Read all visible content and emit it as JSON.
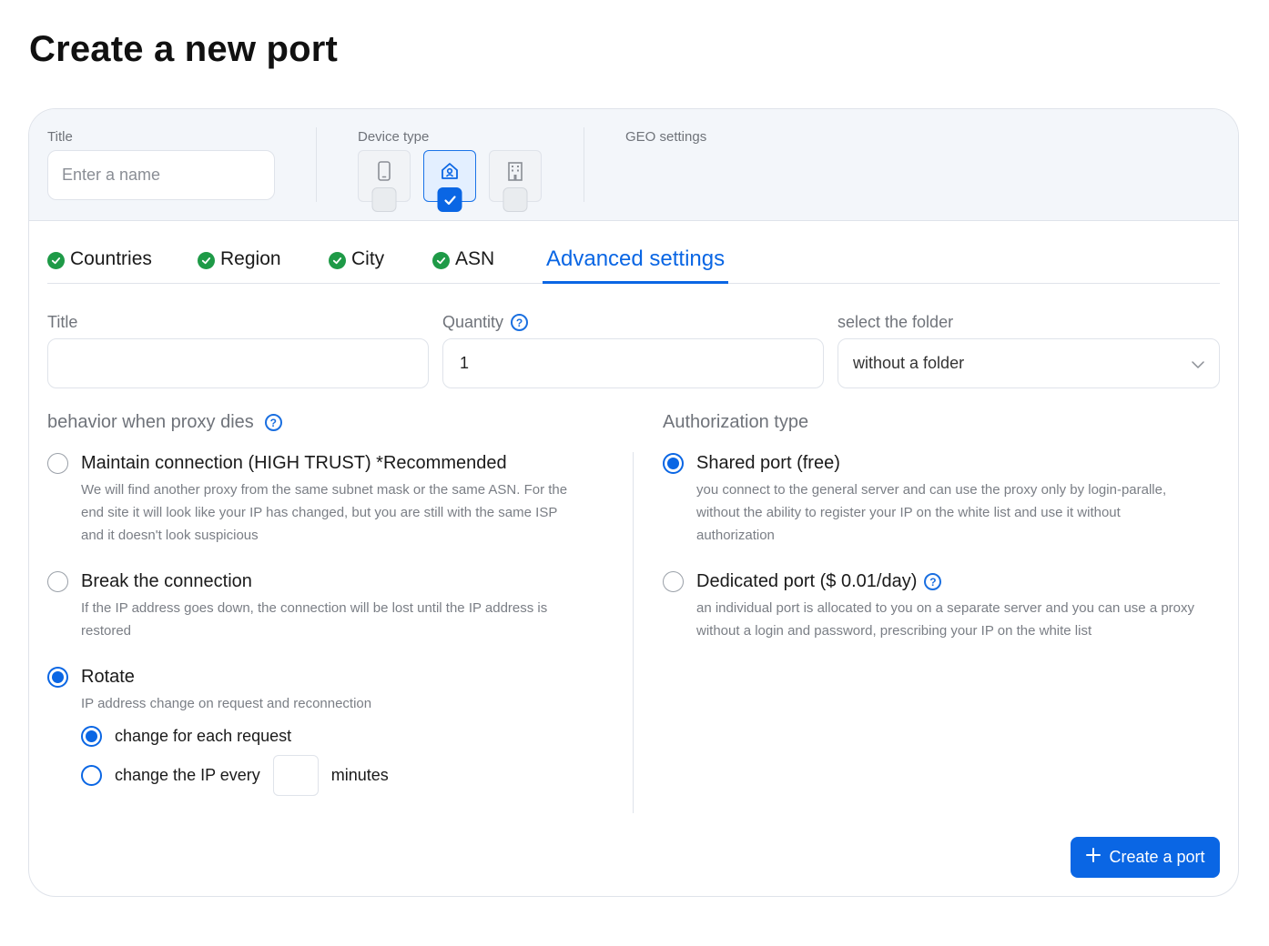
{
  "page": {
    "title": "Create a new port"
  },
  "top_bar": {
    "title_label": "Title",
    "title_placeholder": "Enter a name",
    "device_type_label": "Device type",
    "geo_label": "GEO settings",
    "devices": [
      {
        "icon": "mobile-phone-icon",
        "selected": false
      },
      {
        "icon": "home-icon",
        "selected": true
      },
      {
        "icon": "office-building-icon",
        "selected": false
      }
    ]
  },
  "tabs": [
    {
      "label": "Countries",
      "status": "done"
    },
    {
      "label": "Region",
      "status": "done"
    },
    {
      "label": "City",
      "status": "done"
    },
    {
      "label": "ASN",
      "status": "done"
    },
    {
      "label": "Advanced settings",
      "status": "active"
    }
  ],
  "fields": {
    "title_label": "Title",
    "title_value": "",
    "quantity_label": "Quantity",
    "quantity_value": "1",
    "folder_label": "select the folder",
    "folder_value": "without a folder"
  },
  "behavior": {
    "title": "behavior when proxy dies",
    "options": [
      {
        "label": "Maintain connection (HIGH TRUST) *Recommended",
        "desc": [
          "We will find another proxy from the same subnet mask or the same ASN. For the",
          "end site it will look like your IP has changed, but you are still with the same ISP",
          "and it doesn't look suspicious"
        ],
        "checked": false
      },
      {
        "label": "Break the connection",
        "desc": [
          "If the IP address goes down, the connection will be lost until the IP address is",
          "restored"
        ],
        "checked": false
      },
      {
        "label": "Rotate",
        "desc": [
          "IP address change on request and reconnection"
        ],
        "checked": true
      }
    ],
    "rotate": {
      "each_request_label": "change for each request",
      "every_label": "change the IP every",
      "every_value": "",
      "minutes_label": "minutes"
    }
  },
  "authorization": {
    "title": "Authorization type",
    "options": [
      {
        "label": "Shared port (free)",
        "desc": [
          "you connect to the general server and can use the proxy only by login-paralle,",
          "without the ability to register your IP on the white list and use it without",
          "authorization"
        ],
        "checked": true
      },
      {
        "label": "Dedicated port ($ 0.01/day)",
        "desc": [
          "an individual port is allocated to you on a separate server and you can use a proxy",
          "without a login and password, prescribing your IP on the white list"
        ],
        "checked": false
      }
    ]
  },
  "actions": {
    "create_label": "Create a port"
  },
  "colors": {
    "accent": "#0a66e4",
    "success": "#1e9a47",
    "panel": "#f3f6fa",
    "border": "#dfe3ea"
  }
}
